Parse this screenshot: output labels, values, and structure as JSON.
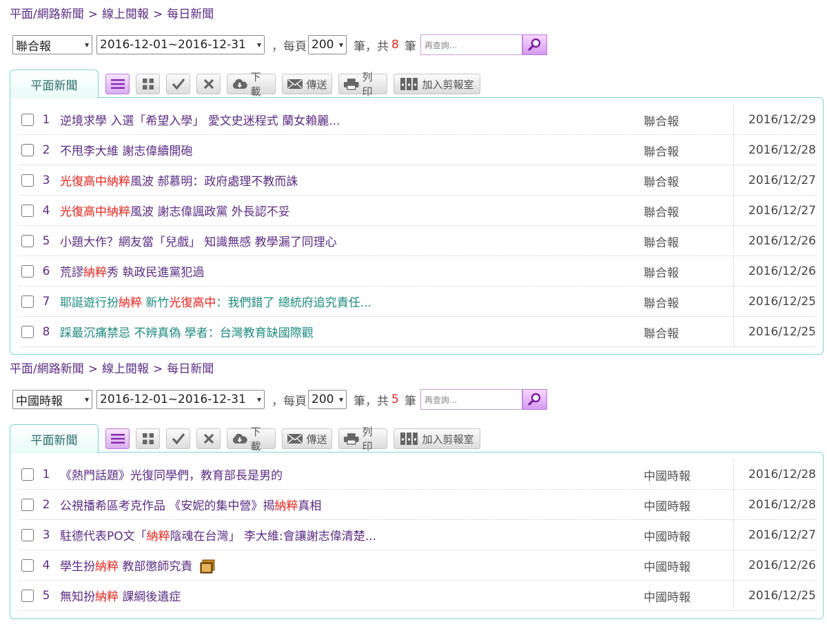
{
  "icons": {
    "caret": "▾",
    "search": "magnifier-icon",
    "list": "list-icon",
    "grid": "grid-icon",
    "check": "check-icon",
    "close": "close-icon",
    "download": "cloud-download-icon",
    "send": "envelope-icon",
    "print": "printer-icon",
    "clip": "binders-icon",
    "photo": "photo-icon"
  },
  "colors": {
    "purple_text": "#5a2d82",
    "teal_text": "#1e8b7e",
    "highlight": "#e0261f",
    "panel_border": "#7fd4c9"
  },
  "sections": [
    {
      "breadcrumb": [
        "平面/網路新聞",
        ">",
        "線上閱報",
        ">",
        "每日新聞"
      ],
      "newspaper": "聯合報",
      "date_range": "2016-12-01~2016-12-31",
      "per_page_label": "，每頁",
      "per_page": "200",
      "count_prefix": "筆，共",
      "count": "8",
      "count_suffix": "筆",
      "search_placeholder": "再查詢...",
      "tab_label": "平面新聞",
      "buttons": {
        "download": "下載",
        "send": "傳送",
        "print": "列印",
        "clip": "加入剪報室"
      },
      "rows": [
        {
          "num": "1",
          "parts": [
            [
              "逆境求學 入選「希望入學」 愛文史迷程式 蘭女賴麗...",
              false
            ]
          ],
          "teal": false,
          "source": "聯合報",
          "date": "2016/12/29"
        },
        {
          "num": "2",
          "parts": [
            [
              "不甩李大維 謝志偉續開砲",
              false
            ]
          ],
          "teal": false,
          "source": "聯合報",
          "date": "2016/12/28"
        },
        {
          "num": "3",
          "parts": [
            [
              "光復高中",
              true
            ],
            [
              "納粹",
              true
            ],
            [
              "風波 郝慕明：政府處理不教而誅",
              false
            ]
          ],
          "teal": false,
          "source": "聯合報",
          "date": "2016/12/27"
        },
        {
          "num": "4",
          "parts": [
            [
              "光復高中",
              true
            ],
            [
              "納粹",
              true
            ],
            [
              "風波 謝志偉諷政黨 外長認不妥",
              false
            ]
          ],
          "teal": false,
          "source": "聯合報",
          "date": "2016/12/27"
        },
        {
          "num": "5",
          "parts": [
            [
              "小題大作？網友當「兒戲」 知識無感 教學漏了同理心",
              false
            ]
          ],
          "teal": false,
          "source": "聯合報",
          "date": "2016/12/26"
        },
        {
          "num": "6",
          "parts": [
            [
              "荒謬",
              false
            ],
            [
              "納粹",
              true
            ],
            [
              "秀 執政民進黨犯過",
              false
            ]
          ],
          "teal": false,
          "source": "聯合報",
          "date": "2016/12/26"
        },
        {
          "num": "7",
          "parts": [
            [
              "耶誕遊行扮",
              false
            ],
            [
              "納粹",
              true
            ],
            [
              " 新竹",
              false
            ],
            [
              "光復高中",
              true
            ],
            [
              "：我們錯了 總統府追究責任...",
              false
            ]
          ],
          "teal": true,
          "source": "聯合報",
          "date": "2016/12/25"
        },
        {
          "num": "8",
          "parts": [
            [
              "踩最沉痛禁忌 不辨真偽 學者：台灣教育缺國際觀",
              false
            ]
          ],
          "teal": true,
          "source": "聯合報",
          "date": "2016/12/25"
        }
      ]
    },
    {
      "breadcrumb": [
        "平面/網路新聞",
        ">",
        "線上閱報",
        ">",
        "每日新聞"
      ],
      "newspaper": "中國時報",
      "date_range": "2016-12-01~2016-12-31",
      "per_page_label": "，每頁",
      "per_page": "200",
      "count_prefix": "筆，共",
      "count": "5",
      "count_suffix": "筆",
      "search_placeholder": "再查詢...",
      "tab_label": "平面新聞",
      "buttons": {
        "download": "下載",
        "send": "傳送",
        "print": "列印",
        "clip": "加入剪報室"
      },
      "rows": [
        {
          "num": "1",
          "parts": [
            [
              "《熱門話題》光復同學們，教育部長是男的",
              false
            ]
          ],
          "teal": false,
          "source": "中國時報",
          "date": "2016/12/28"
        },
        {
          "num": "2",
          "parts": [
            [
              "公視播希區考克作品 《安妮的集中營》揭",
              false
            ],
            [
              "納粹",
              true
            ],
            [
              "真相",
              false
            ]
          ],
          "teal": false,
          "source": "中國時報",
          "date": "2016/12/28"
        },
        {
          "num": "3",
          "parts": [
            [
              "駐德代表PO文「",
              false
            ],
            [
              "納粹",
              true
            ],
            [
              "陰魂在台灣」 李大維:會讓謝志偉清楚...",
              false
            ]
          ],
          "teal": false,
          "source": "中國時報",
          "date": "2016/12/27"
        },
        {
          "num": "4",
          "parts": [
            [
              "學生扮",
              false
            ],
            [
              "納粹",
              true
            ],
            [
              " 教部懲師究責",
              false
            ]
          ],
          "teal": false,
          "photo": true,
          "source": "中國時報",
          "date": "2016/12/26"
        },
        {
          "num": "5",
          "parts": [
            [
              "無知扮",
              false
            ],
            [
              "納粹",
              true
            ],
            [
              " 課綱後遺症",
              false
            ]
          ],
          "teal": false,
          "source": "中國時報",
          "date": "2016/12/25"
        }
      ]
    }
  ]
}
